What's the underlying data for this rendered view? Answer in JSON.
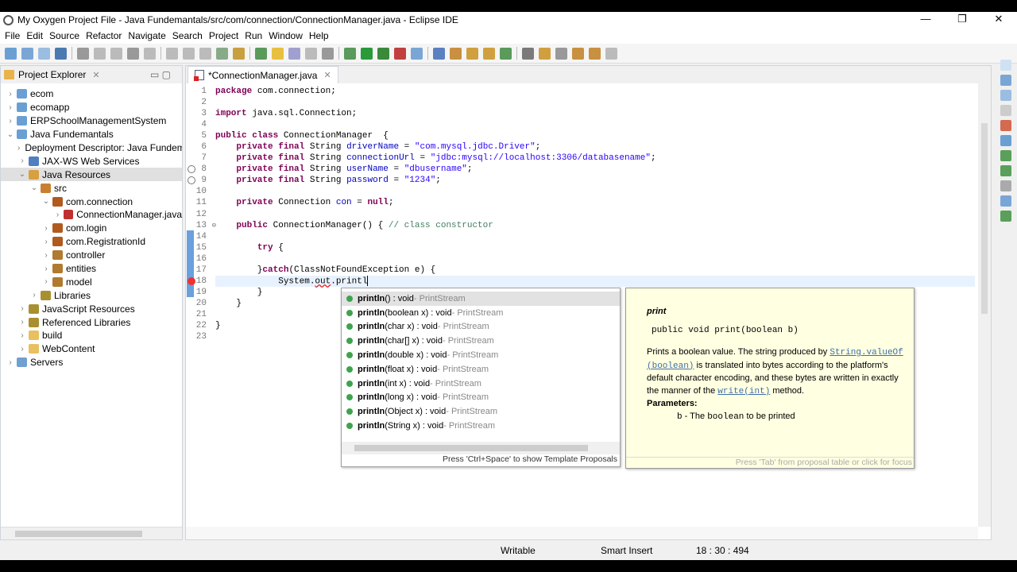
{
  "window": {
    "title": "My Oxygen Project File - Java Fundemantals/src/com/connection/ConnectionManager.java - Eclipse IDE",
    "minimize": "—",
    "maximize": "❐",
    "close": "✕"
  },
  "menu": [
    "File",
    "Edit",
    "Source",
    "Refactor",
    "Navigate",
    "Search",
    "Project",
    "Run",
    "Window",
    "Help"
  ],
  "explorer": {
    "title": "Project Explorer",
    "close": "✕",
    "items": [
      {
        "label": "ecom",
        "level": 0,
        "open": false,
        "color": "#6a9fd4"
      },
      {
        "label": "ecomapp",
        "level": 0,
        "open": false,
        "color": "#6a9fd4"
      },
      {
        "label": "ERPSchoolManagementSystem",
        "level": 0,
        "open": false,
        "color": "#6a9fd4"
      },
      {
        "label": "Java Fundemantals",
        "level": 0,
        "open": true,
        "color": "#6a9fd4"
      },
      {
        "label": "Deployment Descriptor: Java Fundemantals",
        "level": 1,
        "open": false,
        "color": "#7a9a7a"
      },
      {
        "label": "JAX-WS Web Services",
        "level": 1,
        "open": false,
        "color": "#5080c0"
      },
      {
        "label": "Java Resources",
        "level": 1,
        "open": true,
        "color": "#d8a040",
        "selected": true
      },
      {
        "label": "src",
        "level": 2,
        "open": true,
        "color": "#c88030"
      },
      {
        "label": "com.connection",
        "level": 3,
        "open": true,
        "color": "#b05a20"
      },
      {
        "label": "ConnectionManager.java",
        "level": 4,
        "open": false,
        "color": "#c03030"
      },
      {
        "label": "com.login",
        "level": 3,
        "open": false,
        "color": "#b05a20"
      },
      {
        "label": "com.RegistrationId",
        "level": 3,
        "open": false,
        "color": "#b05a20"
      },
      {
        "label": "controller",
        "level": 3,
        "open": false,
        "color": "#b07a30"
      },
      {
        "label": "entities",
        "level": 3,
        "open": false,
        "color": "#b07a30"
      },
      {
        "label": "model",
        "level": 3,
        "open": false,
        "color": "#b07a30"
      },
      {
        "label": "Libraries",
        "level": 2,
        "open": false,
        "color": "#a89030"
      },
      {
        "label": "JavaScript Resources",
        "level": 1,
        "open": false,
        "color": "#a89030"
      },
      {
        "label": "Referenced Libraries",
        "level": 1,
        "open": false,
        "color": "#a89030"
      },
      {
        "label": "build",
        "level": 1,
        "open": false,
        "color": "#e8c060"
      },
      {
        "label": "WebContent",
        "level": 1,
        "open": false,
        "color": "#e8c060"
      },
      {
        "label": "Servers",
        "level": 0,
        "open": false,
        "color": "#70a0d0"
      }
    ]
  },
  "editor": {
    "tab": "*ConnectionManager.java",
    "close": "✕",
    "lines": [
      [
        [
          "kw",
          "package"
        ],
        [
          "",
          "com.connection;"
        ]
      ],
      [],
      [
        [
          "kw",
          "import"
        ],
        [
          "",
          "java.sql.Connection;"
        ]
      ],
      [],
      [
        [
          "kw",
          "public"
        ],
        [
          "",
          " "
        ],
        [
          "kw",
          "class"
        ],
        [
          "",
          " ConnectionManager  {"
        ]
      ],
      [
        [
          "",
          "    "
        ],
        [
          "kw",
          "private"
        ],
        [
          "",
          " "
        ],
        [
          "kw",
          "final"
        ],
        [
          "",
          " String "
        ],
        [
          "fld",
          "driverName"
        ],
        [
          "",
          " = "
        ],
        [
          "str",
          "\"com.mysql.jdbc.Driver\""
        ],
        [
          "",
          ";"
        ]
      ],
      [
        [
          "",
          "    "
        ],
        [
          "kw",
          "private"
        ],
        [
          "",
          " "
        ],
        [
          "kw",
          "final"
        ],
        [
          "",
          " String "
        ],
        [
          "fld",
          "connectionUrl"
        ],
        [
          "",
          " = "
        ],
        [
          "str",
          "\"jdbc:mysql://localhost:3306/databasename\""
        ],
        [
          "",
          ";"
        ]
      ],
      [
        [
          "",
          "    "
        ],
        [
          "kw",
          "private"
        ],
        [
          "",
          " "
        ],
        [
          "kw",
          "final"
        ],
        [
          "",
          " String "
        ],
        [
          "fld",
          "userName"
        ],
        [
          "",
          " = "
        ],
        [
          "str",
          "\"dbusername\""
        ],
        [
          "",
          ";"
        ]
      ],
      [
        [
          "",
          "    "
        ],
        [
          "kw",
          "private"
        ],
        [
          "",
          " "
        ],
        [
          "kw",
          "final"
        ],
        [
          "",
          " String "
        ],
        [
          "fld",
          "password"
        ],
        [
          "",
          " = "
        ],
        [
          "str",
          "\"1234\""
        ],
        [
          "",
          ";"
        ]
      ],
      [],
      [
        [
          "",
          "    "
        ],
        [
          "kw",
          "private"
        ],
        [
          "",
          " Connection "
        ],
        [
          "fld",
          "con"
        ],
        [
          "",
          " = "
        ],
        [
          "kw",
          "null"
        ],
        [
          "",
          ";"
        ]
      ],
      [],
      [
        [
          "",
          "    "
        ],
        [
          "kw",
          "public"
        ],
        [
          "",
          " ConnectionManager() { "
        ],
        [
          "cmt",
          "// class constructor"
        ]
      ],
      [],
      [
        [
          "",
          "        "
        ],
        [
          "kw",
          "try"
        ],
        [
          "",
          " {"
        ]
      ],
      [],
      [
        [
          "",
          "        }"
        ],
        [
          "kw",
          "catch"
        ],
        [
          "",
          "(ClassNotFoundException e) {"
        ]
      ],
      [
        [
          "",
          "            System."
        ],
        [
          "err",
          "out"
        ],
        [
          "",
          ".printl"
        ]
      ],
      [
        [
          "",
          "        }"
        ]
      ],
      [
        [
          "",
          "    }"
        ]
      ],
      [],
      [
        [
          "",
          "}"
        ]
      ],
      []
    ]
  },
  "autocomplete": {
    "items": [
      {
        "sig": "println() : void",
        "owner": "PrintStream"
      },
      {
        "sig": "println(boolean x) : void",
        "owner": "PrintStream"
      },
      {
        "sig": "println(char x) : void",
        "owner": "PrintStream"
      },
      {
        "sig": "println(char[] x) : void",
        "owner": "PrintStream"
      },
      {
        "sig": "println(double x) : void",
        "owner": "PrintStream"
      },
      {
        "sig": "println(float x) : void",
        "owner": "PrintStream"
      },
      {
        "sig": "println(int x) : void",
        "owner": "PrintStream"
      },
      {
        "sig": "println(long x) : void",
        "owner": "PrintStream"
      },
      {
        "sig": "println(Object x) : void",
        "owner": "PrintStream"
      },
      {
        "sig": "println(String x) : void",
        "owner": "PrintStream"
      }
    ],
    "footer": "Press 'Ctrl+Space' to show Template Proposals"
  },
  "doc": {
    "heading": "print",
    "signature": "public void print(boolean b)",
    "p1": "Prints a boolean value. The string produced by ",
    "link1": "String.valueOf (boolean)",
    "p2": " is translated into bytes according to the platform's default character encoding, and these bytes are written in exactly the manner of the ",
    "link2": "write(int)",
    "p3": " method.",
    "params_label": "Parameters:",
    "param_name": "b",
    "param_desc": " - The ",
    "param_code": "boolean",
    "param_tail": " to be printed",
    "footer": "Press 'Tab' from proposal table or click for focus"
  },
  "status": {
    "mode": "Writable",
    "insert": "Smart Insert",
    "position": "18 : 30 : 494"
  }
}
